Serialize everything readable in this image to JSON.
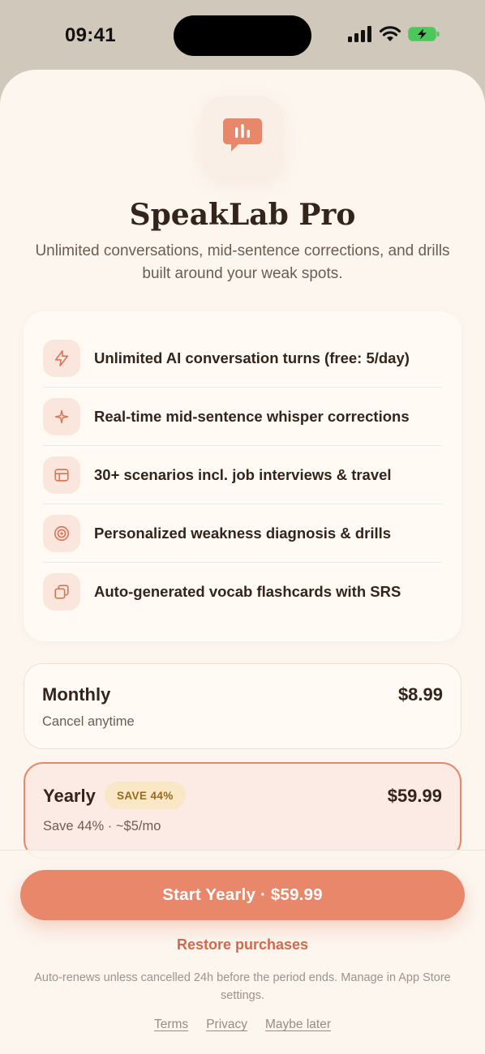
{
  "status_bar": {
    "time": "09:41"
  },
  "header": {
    "title": "SpeakLab Pro",
    "subtitle": "Unlimited conversations, mid-sentence corrections, and drills built around your weak spots."
  },
  "features": [
    {
      "icon": "lightning-icon",
      "text": "Unlimited AI conversation turns (free: 5/day)"
    },
    {
      "icon": "sparkle-icon",
      "text": "Real-time mid-sentence whisper corrections"
    },
    {
      "icon": "layout-icon",
      "text": "30+ scenarios incl. job interviews & travel"
    },
    {
      "icon": "target-icon",
      "text": "Personalized weakness diagnosis & drills"
    },
    {
      "icon": "cards-icon",
      "text": "Auto-generated vocab flashcards with SRS"
    }
  ],
  "plans": {
    "monthly": {
      "name": "Monthly",
      "price": "$8.99",
      "sub": "Cancel anytime"
    },
    "yearly": {
      "name": "Yearly",
      "badge": "SAVE 44%",
      "price": "$59.99",
      "sub": "Save 44% · ~$5/mo",
      "selected": true
    }
  },
  "footer": {
    "cta": "Start Yearly · $59.99",
    "restore": "Restore purchases",
    "legal": "Auto-renews unless cancelled 24h before the period ends. Manage in App Store settings.",
    "links": [
      "Terms",
      "Privacy",
      "Maybe later"
    ]
  },
  "colors": {
    "accent": "#e8876a",
    "background": "#fcf6ef",
    "text": "#33241c",
    "badge_bg": "#f9e7c6"
  }
}
